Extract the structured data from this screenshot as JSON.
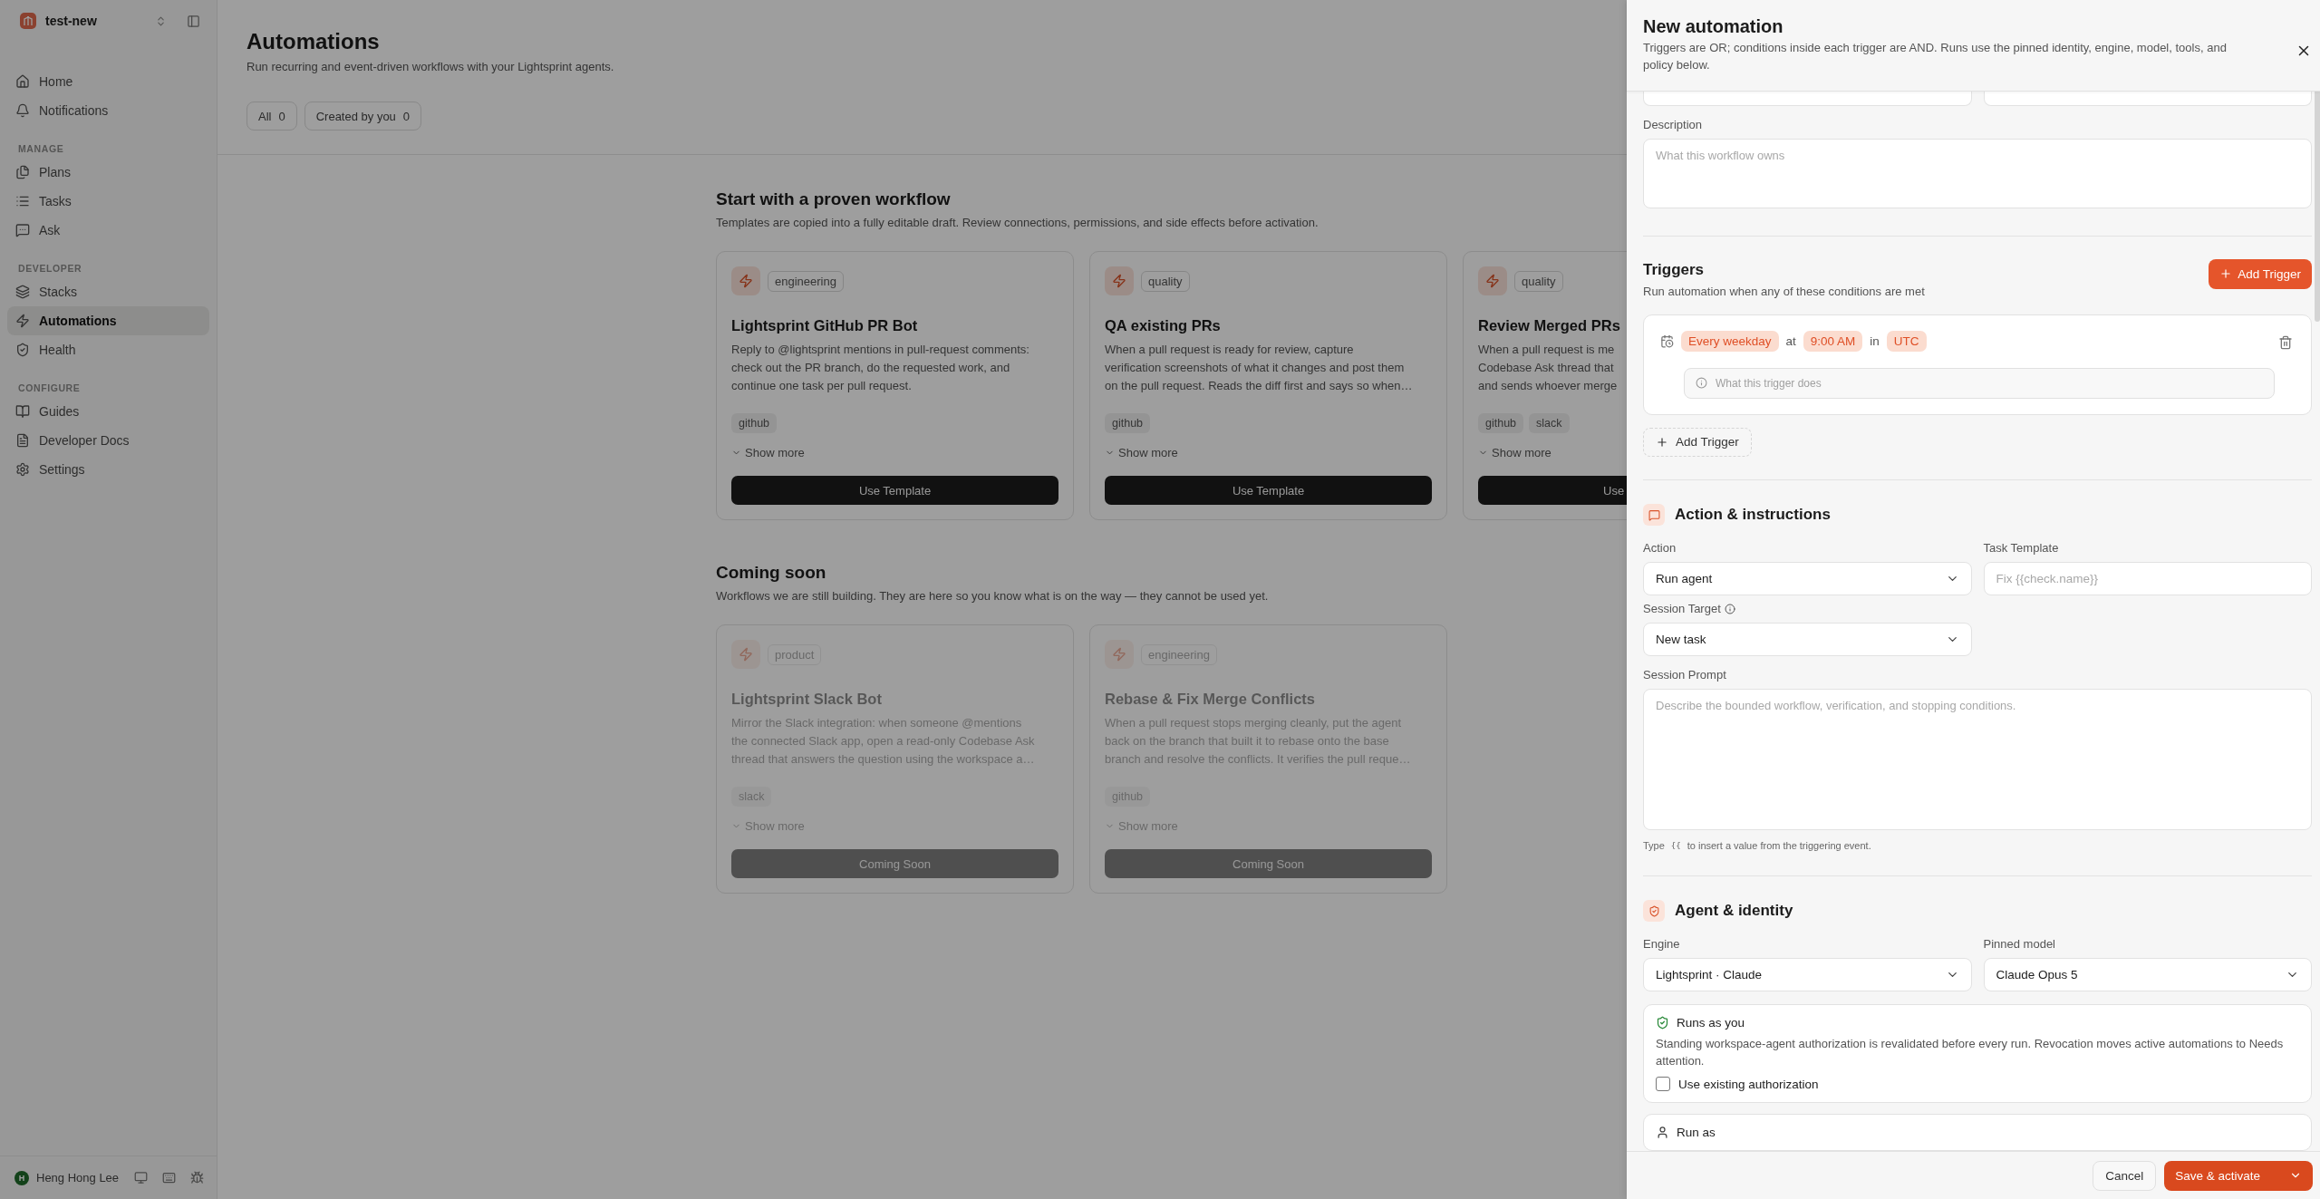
{
  "sidebar": {
    "workspace": "test-new",
    "sections": [
      {
        "items": [
          {
            "label": "Home",
            "selected": false
          },
          {
            "label": "Notifications",
            "selected": false
          }
        ]
      },
      {
        "heading": "MANAGE",
        "items": [
          {
            "label": "Plans",
            "selected": false
          },
          {
            "label": "Tasks",
            "selected": false
          },
          {
            "label": "Ask",
            "selected": false
          }
        ]
      },
      {
        "heading": "DEVELOPER",
        "items": [
          {
            "label": "Stacks",
            "selected": false
          },
          {
            "label": "Automations",
            "selected": true
          },
          {
            "label": "Health",
            "selected": false
          }
        ]
      },
      {
        "heading": "CONFIGURE",
        "items": [
          {
            "label": "Guides",
            "selected": false
          },
          {
            "label": "Developer Docs",
            "selected": false
          },
          {
            "label": "Settings",
            "selected": false
          }
        ]
      }
    ],
    "user": {
      "initial": "H",
      "name": "Heng Hong Lee"
    }
  },
  "page": {
    "title": "Automations",
    "subtitle": "Run recurring and event-driven workflows with your Lightsprint agents.",
    "filters": [
      {
        "label": "All",
        "count": "0"
      },
      {
        "label": "Created by you",
        "count": "0"
      }
    ]
  },
  "templates": {
    "title": "Start with a proven workflow",
    "subtitle": "Templates are copied into a fully editable draft. Review connections, permissions, and side effects before activation.",
    "cards": [
      {
        "category": "engineering",
        "title": "Lightsprint GitHub PR Bot",
        "description": "Reply to @lightsprint mentions in pull-request comments:\ncheck out the PR branch, do the requested work, and\ncontinue one task per pull request.",
        "tags": [
          "github"
        ],
        "show_more": "Show more",
        "button": "Use Template",
        "disabled": false,
        "clipped": false
      },
      {
        "category": "quality",
        "title": "QA existing PRs",
        "description": "When a pull request is ready for review, capture\nverification screenshots of what it changes and post them\non the pull request. Reads the diff first and says so when…",
        "tags": [
          "github"
        ],
        "show_more": "Show more",
        "button": "Use Template",
        "disabled": false,
        "clipped": false
      },
      {
        "category": "quality",
        "title": "Review Merged PRs",
        "description": "When a pull request is me\nCodebase Ask thread that\nand sends whoever merge",
        "tags": [
          "github",
          "slack"
        ],
        "show_more": "Show more",
        "button": "Use",
        "disabled": false,
        "clipped": true
      }
    ]
  },
  "coming_soon": {
    "title": "Coming soon",
    "subtitle": "Workflows we are still building. They are here so you know what is on the way — they cannot be used yet.",
    "cards": [
      {
        "category": "product",
        "title": "Lightsprint Slack Bot",
        "description": "Mirror the Slack integration: when someone @mentions\nthe connected Slack app, open a read-only Codebase Ask\nthread that answers the question using the workspace a…",
        "tags": [
          "slack"
        ],
        "show_more": "Show more",
        "button": "Coming Soon",
        "disabled": true,
        "clipped": false
      },
      {
        "category": "engineering",
        "title": "Rebase & Fix Merge Conflicts",
        "description": "When a pull request stops merging cleanly, put the agent\nback on the branch that built it to rebase onto the base\nbranch and resolve the conflicts. It verifies the pull reque…",
        "tags": [
          "github"
        ],
        "show_more": "Show more",
        "button": "Coming Soon",
        "disabled": true,
        "clipped": false
      }
    ]
  },
  "drawer": {
    "title": "New automation",
    "subtitle": "Triggers are OR; conditions inside each trigger are AND. Runs use the pinned identity, engine, model, tools, and policy below.",
    "description": {
      "label": "Description",
      "placeholder": "What this workflow owns"
    },
    "triggers": {
      "title": "Triggers",
      "subtitle": "Run automation when any of these conditions are met",
      "add_button": "Add Trigger",
      "items": [
        {
          "parts": [
            {
              "kind": "chip",
              "text": "Every weekday"
            },
            {
              "kind": "word",
              "text": "at"
            },
            {
              "kind": "chip",
              "text": "9:00 AM"
            },
            {
              "kind": "word",
              "text": "in"
            },
            {
              "kind": "chip",
              "text": "UTC"
            }
          ],
          "placeholder": "What this trigger does"
        }
      ],
      "add_link": "Add Trigger"
    },
    "action": {
      "title": "Action & instructions",
      "action": {
        "label": "Action",
        "value": "Run agent"
      },
      "task_template": {
        "label": "Task Template",
        "placeholder": "Fix {{check.name}}"
      },
      "session_target": {
        "label": "Session Target",
        "value": "New task"
      },
      "session_prompt": {
        "label": "Session Prompt",
        "placeholder": "Describe the bounded workflow, verification, and stopping conditions."
      },
      "hint": {
        "before": "Type",
        "token": "{{",
        "after": "to insert a value from the triggering event."
      }
    },
    "agent": {
      "title": "Agent & identity",
      "engine": {
        "label": "Engine",
        "value": "Lightsprint · Claude"
      },
      "model": {
        "label": "Pinned model",
        "value": "Claude Opus 5"
      },
      "runs_as_you": {
        "title": "Runs as you",
        "text": "Standing workspace-agent authorization is revalidated before every run. Revocation moves active automations to Needs attention.",
        "checkbox": {
          "label": "Use existing authorization",
          "checked": false
        }
      },
      "run_as": {
        "title": "Run as"
      }
    },
    "footer": {
      "cancel": "Cancel",
      "primary": "Save & activate"
    }
  }
}
